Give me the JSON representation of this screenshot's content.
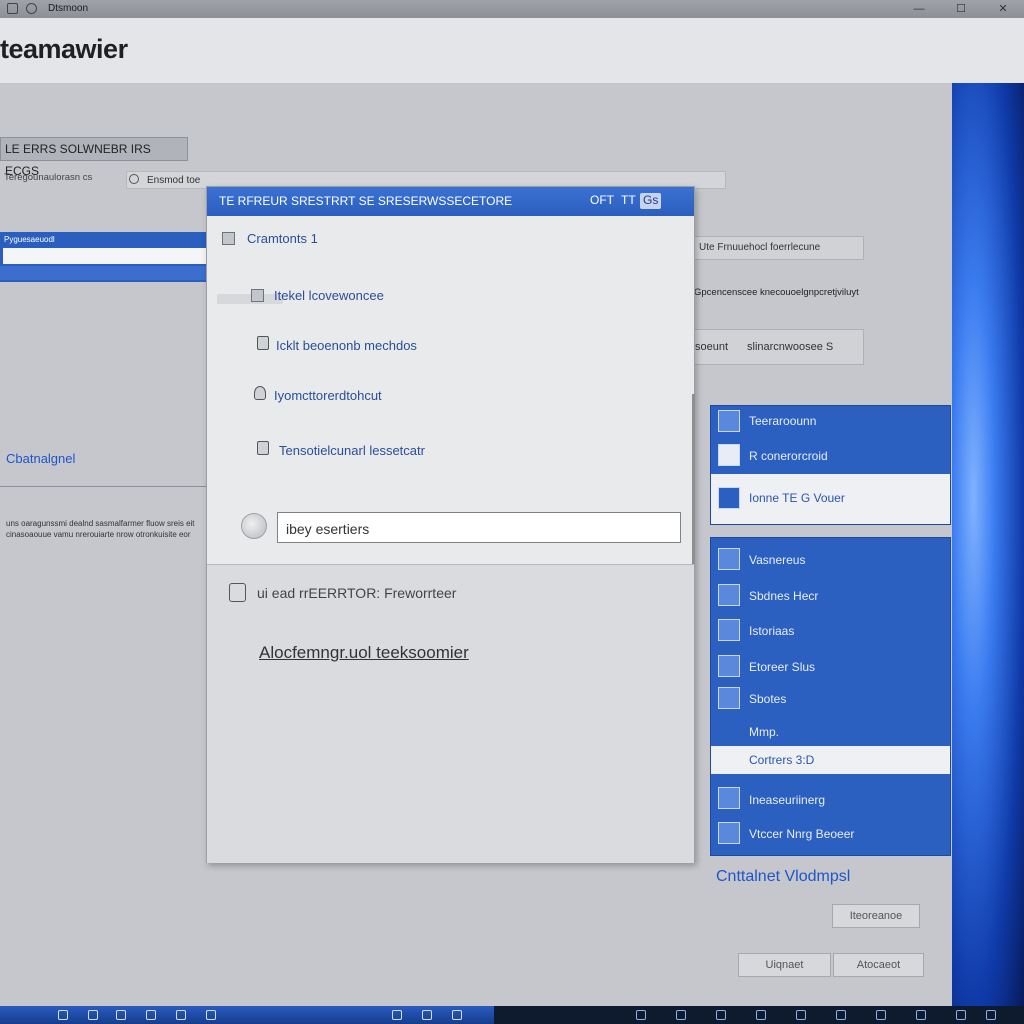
{
  "window": {
    "title": "Dtsmoon"
  },
  "app": {
    "logo": "teamawier"
  },
  "left_panel": {
    "header": "LE ERRS SOLWNEBR IRS ECGS",
    "subtext": "Teregounaulorasn cs",
    "search_text": "Ensmod toe",
    "blue_label": "Pyguesaeuodl",
    "link": "Cbatnalgnel",
    "paragraph": "uns oaragunssmi dealnd sasmalfarmer fluow sreis eit cinasoaouue vamu nrerouiarte nrow otronkuisite eor"
  },
  "dialog": {
    "title": "TE RFREUR SRESTRRT SE SRESERWSSECETORE",
    "title_buttons": [
      "OFT",
      "TT",
      "Gs"
    ],
    "group_label": "Cramtonts 1",
    "options": [
      {
        "label": "Itekel lcovewoncee",
        "icon": "checkbox-icon"
      },
      {
        "label": "Icklt beoenonb mechdos",
        "icon": "hand-icon"
      },
      {
        "label": "Iyomcttorerdtohcut",
        "icon": "bell-icon"
      },
      {
        "label": "Tensotielcunarl lessetcatr",
        "icon": "document-icon"
      }
    ],
    "input_value": "ibey esertiers",
    "bottom_title": "ui ead rrEERRTOR: Freworrteer",
    "bottom_link": "Alocfemngr.uol teeksoomier"
  },
  "right_panel": {
    "field1": "Ute Frnuuehocl foerrlecune",
    "line": "Gpcencenscee knecouoelgnpcretjviluyt",
    "field2_a": "soeunt",
    "field2_b": "slinarcnwoosee S",
    "list1": [
      {
        "label": "Teeraroounn",
        "icon": "user-icon",
        "selected": false
      },
      {
        "label": "R conerorcroid",
        "icon": "qr-code-icon",
        "selected": false
      },
      {
        "label": "Ionne TE G Vouer",
        "icon": "image-icon",
        "selected": true
      }
    ],
    "list2": [
      {
        "label": "Vasnereus",
        "icon": "folder-icon",
        "selected": false
      },
      {
        "label": "Sbdnes Hecr",
        "icon": "settings-icon",
        "selected": false
      },
      {
        "label": "Istoriaas",
        "icon": "grid-icon",
        "selected": false
      },
      {
        "label": "Etoreer Slus",
        "icon": "media-icon",
        "selected": false
      },
      {
        "label": "Sbotes",
        "icon": "tools-icon",
        "selected": false
      },
      {
        "label": "Mmp.",
        "icon": "pen-icon",
        "selected": false
      },
      {
        "label": "Cortrers 3:D",
        "icon": "cube-icon",
        "selected": true
      },
      {
        "label": "Ineaseuriinerg",
        "icon": "link-icon",
        "selected": false
      },
      {
        "label": "Vtccer Nnrg Beoeer",
        "icon": "monitor-icon",
        "selected": false
      }
    ],
    "link": "Cnttalnet Vlodmpsl",
    "button1": "Iteoreanoe",
    "button_ok": "Uiqnaet",
    "button_cancel": "Atocaeot"
  },
  "colors": {
    "accent": "#2a5fbf",
    "link": "#1f55c8",
    "panel": "#c5c7cc",
    "dialog": "#e9eaec"
  }
}
